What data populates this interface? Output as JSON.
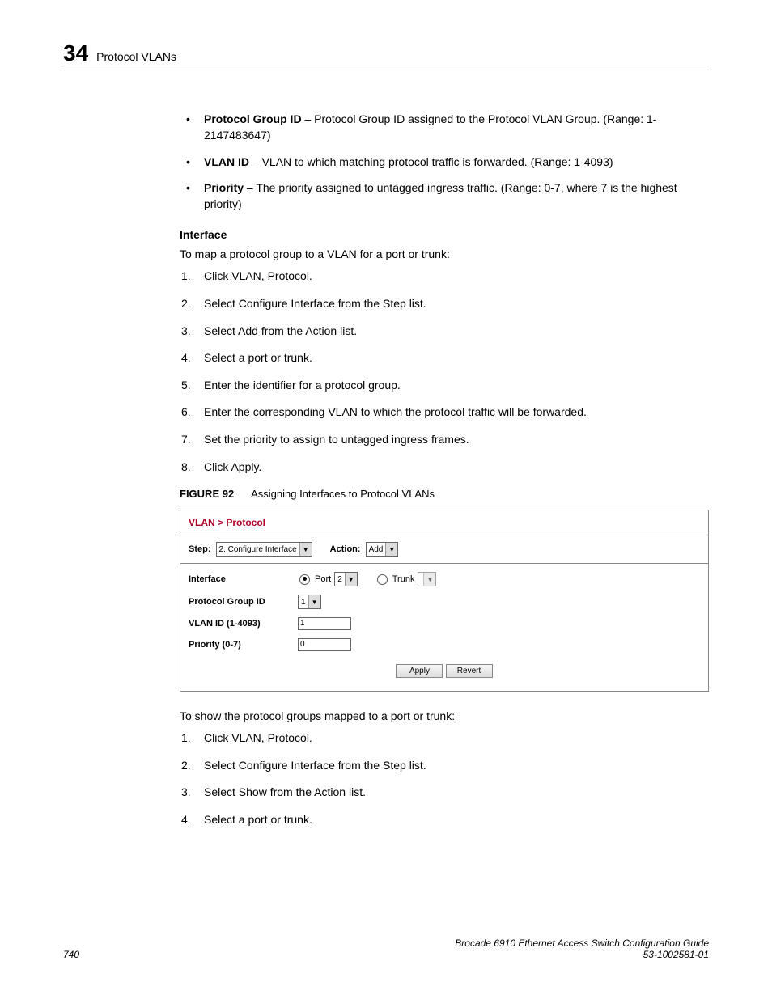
{
  "header": {
    "chapter_number": "34",
    "title": "Protocol VLANs"
  },
  "defs": {
    "items": [
      {
        "term": "Protocol Group ID",
        "desc": " – Protocol Group ID assigned to the Protocol VLAN Group. (Range: 1-2147483647)"
      },
      {
        "term": "VLAN ID",
        "desc": " – VLAN to which matching protocol traffic is forwarded. (Range: 1-4093)"
      },
      {
        "term": "Priority",
        "desc": " – The priority assigned to untagged ingress traffic. (Range: 0-7, where 7 is the highest priority)"
      }
    ]
  },
  "interface": {
    "heading": "Interface",
    "intro": "To map a protocol group to a VLAN for a port or trunk:",
    "steps": [
      "Click VLAN, Protocol.",
      "Select Configure Interface from the Step list.",
      "Select Add from the Action list.",
      "Select a port or trunk.",
      "Enter the identifier for a protocol group.",
      "Enter the corresponding VLAN to which the protocol traffic will be forwarded.",
      "Set the priority to assign to untagged ingress frames.",
      "Click Apply."
    ]
  },
  "figure": {
    "label": "FIGURE 92",
    "title": "Assigning Interfaces to Protocol VLANs"
  },
  "panel": {
    "title": "VLAN > Protocol",
    "toolbar": {
      "step_label": "Step:",
      "step_value": "2. Configure Interface",
      "action_label": "Action:",
      "action_value": "Add"
    },
    "form": {
      "interface_label": "Interface",
      "port_label": "Port",
      "port_value": "2",
      "trunk_label": "Trunk",
      "trunk_value": " ",
      "pgid_label": "Protocol Group ID",
      "pgid_value": "1",
      "vlan_label": "VLAN ID (1-4093)",
      "vlan_value": "1",
      "prio_label": "Priority (0-7)",
      "prio_value": "0"
    },
    "buttons": {
      "apply": "Apply",
      "revert": "Revert"
    }
  },
  "show": {
    "intro": "To show the protocol groups mapped to a port or trunk:",
    "steps": [
      "Click VLAN, Protocol.",
      "Select Configure Interface from the Step list.",
      "Select Show from the Action list.",
      "Select a port or trunk."
    ]
  },
  "footer": {
    "page": "740",
    "guide": "Brocade 6910 Ethernet Access Switch Configuration Guide",
    "docnum": "53-1002581-01"
  }
}
